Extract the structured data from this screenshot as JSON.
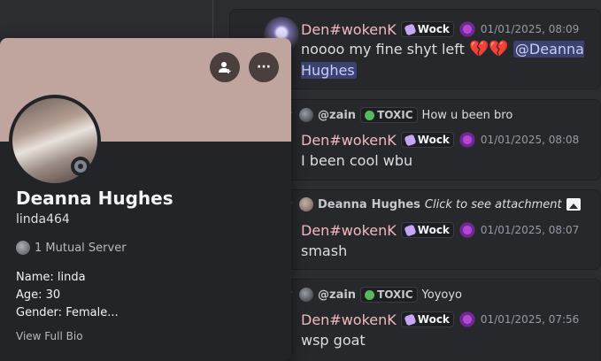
{
  "messages": [
    {
      "author": "Den#wokenK",
      "tag": "Wock",
      "timestamp": "01/01/2025, 08:09",
      "text": "noooo my fine shyt left",
      "mention": "@Deanna Hughes"
    },
    {
      "reply": {
        "name": "@zain",
        "tag": "TOXIC",
        "text": "How u been bro"
      },
      "author": "Den#wokenK",
      "tag": "Wock",
      "timestamp": "01/01/2025, 08:08",
      "text": "I been cool wbu"
    },
    {
      "reply": {
        "name": "Deanna",
        "name2": "Hughes",
        "text": "Click to see attachment"
      },
      "author": "Den#wokenK",
      "tag": "Wock",
      "timestamp": "01/01/2025, 08:07",
      "text": "smash"
    },
    {
      "reply": {
        "name": "@zain",
        "tag": "TOXIC",
        "text": "Yoyoyo"
      },
      "author": "Den#wokenK",
      "tag": "Wock",
      "timestamp": "01/01/2025, 07:56",
      "text": "wsp goat"
    }
  ],
  "profile": {
    "display_name": "Deanna Hughes",
    "username": "linda464",
    "mutual": "1 Mutual Server",
    "bio_name": "Name: linda",
    "bio_age": "Age: 30",
    "bio_gender": "Gender: Female...",
    "view_full_bio": "View Full Bio",
    "more_glyph": "···"
  },
  "colors": {
    "banner": "#bfa59d",
    "author": "#f4b9c0",
    "mention_bg": "#3c4270"
  }
}
